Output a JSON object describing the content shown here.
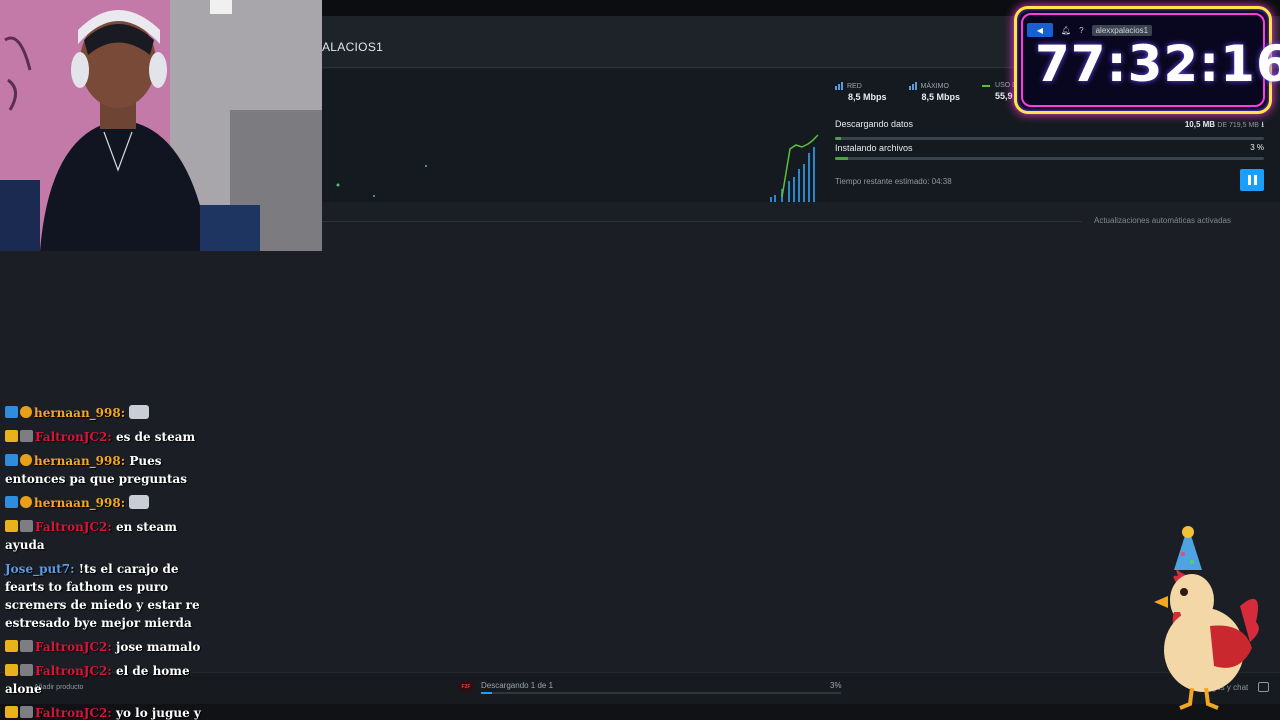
{
  "steam": {
    "user_title": "ALACIOS1",
    "stats": [
      {
        "label": "RED",
        "value": "8,5 Mbps",
        "icon": "bars-icon"
      },
      {
        "label": "MÁXIMO",
        "value": "8,5 Mbps",
        "icon": "bars-icon"
      },
      {
        "label": "USO DEL DISCO",
        "value": "55,9 MB/s",
        "icon": "line-icon"
      }
    ],
    "download": {
      "label": "Descargando datos",
      "amount": "10,5 MB",
      "of_label": "DE 719,5 MB",
      "progress": 0.015
    },
    "install": {
      "label": "Instalando archivos",
      "percent": "3 %",
      "progress": 0.03
    },
    "time_left": "Tiempo restante estimado: 04:38",
    "auto_updates": "Actualizaciones automáticas activadas",
    "bottom": {
      "add_product": "Añadir producto",
      "game_icon_text": "F2F",
      "downloading": "Descargando 1 de 1",
      "percent": "3%",
      "progress": 0.03,
      "friends_chat": "Amigos y chat"
    },
    "colors": {
      "accent": "#1a9fff",
      "progress_green": "#4da04a"
    }
  },
  "timer": {
    "account": "alexxpalacios1",
    "time": "77:32:16",
    "icons": [
      "megaphone-icon",
      "bell-icon",
      "help-icon"
    ]
  },
  "chat": [
    {
      "user": "hernaan_998:",
      "text": "",
      "emote": true,
      "color": "orange",
      "badges": [
        "blue",
        "orange"
      ]
    },
    {
      "user": "FaltronJC2:",
      "text": "es de steam",
      "emote": false,
      "color": "red",
      "badges": [
        "crown",
        "dice"
      ]
    },
    {
      "user": "hernaan_998:",
      "text": "Pues entonces pa que preguntas",
      "emote": false,
      "color": "orange",
      "badges": [
        "blue",
        "orange"
      ]
    },
    {
      "user": "hernaan_998:",
      "text": "",
      "emote": true,
      "color": "orange",
      "badges": [
        "blue",
        "orange"
      ]
    },
    {
      "user": "FaltronJC2:",
      "text": "en steam ayuda",
      "emote": false,
      "color": "red",
      "badges": [
        "crown",
        "dice"
      ]
    },
    {
      "user": "Jose_put7:",
      "text": "!ts el carajo de fearts to fathom es puro scremers de miedo y estar re estresado bye mejor mierda",
      "emote": false,
      "color": "blue",
      "badges": []
    },
    {
      "user": "FaltronJC2:",
      "text": "jose mamalo",
      "emote": false,
      "color": "red",
      "badges": [
        "crown",
        "dice"
      ]
    },
    {
      "user": "FaltronJC2:",
      "text": "el de home alone",
      "emote": false,
      "color": "red",
      "badges": [
        "crown",
        "dice"
      ]
    },
    {
      "user": "FaltronJC2:",
      "text": "yo lo jugue y ame",
      "emote": false,
      "color": "red",
      "badges": [
        "crown",
        "dice"
      ]
    }
  ]
}
